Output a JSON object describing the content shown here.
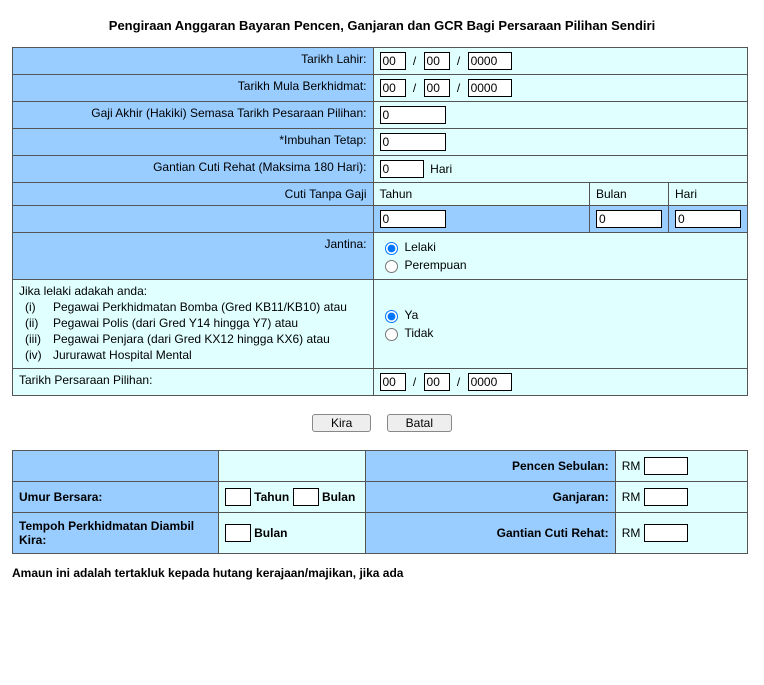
{
  "title": "Pengiraan Anggaran Bayaran Pencen, Ganjaran dan GCR Bagi Persaraan Pilihan Sendiri",
  "labels": {
    "tarikh_lahir": "Tarikh Lahir:",
    "tarikh_mula": "Tarikh Mula Berkhidmat:",
    "gaji_akhir": "Gaji Akhir (Hakiki) Semasa Tarikh Pesaraan Pilihan:",
    "imbuhan": "*Imbuhan Tetap:",
    "gcr_label": "Gantian Cuti Rehat (Maksima 180 Hari):",
    "hari": "Hari",
    "cuti_tanpa_gaji": "Cuti Tanpa Gaji",
    "tahun_h": "Tahun",
    "bulan_h": "Bulan",
    "hari_h": "Hari",
    "jantina": "Jantina:",
    "lelaki": "Lelaki",
    "perempuan": "Perempuan",
    "lelaki_q": "Jika lelaki adakah anda:",
    "cat1": "Pegawai Perkhidmatan Bomba (Gred KB11/KB10) atau",
    "cat2": "Pegawai Polis (dari Gred Y14 hingga Y7) atau",
    "cat3": "Pegawai Penjara (dari Gred KX12 hingga KX6) atau",
    "cat4": "Jururawat Hospital Mental",
    "ya": "Ya",
    "tidak": "Tidak",
    "tarikh_persaraan": "Tarikh Persaraan Pilihan:",
    "kira": "Kira",
    "batal": "Batal",
    "pencen": "Pencen Sebulan:",
    "umur_bersara": "Umur Bersara:",
    "ganjaran": "Ganjaran:",
    "tempoh": "Tempoh Perkhidmatan Diambil Kira:",
    "gcr_res": "Gantian Cuti Rehat:",
    "tahun": "Tahun",
    "bulan": "Bulan",
    "rm": "RM",
    "footer": "Amaun ini adalah tertakluk kepada hutang kerajaan/majikan, jika ada"
  },
  "values": {
    "dob_d": "00",
    "dob_m": "00",
    "dob_y": "0000",
    "svc_d": "00",
    "svc_m": "00",
    "svc_y": "0000",
    "gaji": "0",
    "imbuhan": "0",
    "gcr_days": "0",
    "ctg_tahun": "0",
    "ctg_bulan": "0",
    "ctg_hari": "0",
    "ret_d": "00",
    "ret_m": "00",
    "ret_y": "0000",
    "umur_tahun": "",
    "umur_bulan": "",
    "tempoh_bulan": "",
    "res_pencen": "",
    "res_ganjaran": "",
    "res_gcr": ""
  }
}
